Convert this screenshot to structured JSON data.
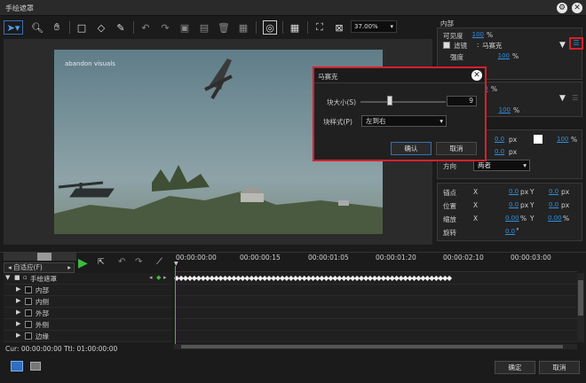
{
  "window": {
    "title": "手绘遮罩"
  },
  "toolbar": {
    "zoom": "37.00%"
  },
  "preview": {
    "watermark": "abandon visuals"
  },
  "props": {
    "section_inside": "内部",
    "visibility_label": "可见度",
    "visibility_value": "100",
    "pct": "%",
    "filter_label": "滤镜",
    "filter_value": "马赛克",
    "strength_label": "强度",
    "strength_value": "100",
    "pct2": "%",
    "visibility2_value": "0",
    "strength2_value": "100",
    "px1": "0.0",
    "px_unit": "px",
    "color_pct": "100",
    "px2": "0.0",
    "direction_label": "方向",
    "direction_value": "两者",
    "anchor_label": "锚点",
    "position_label": "位置",
    "scale_label": "缩放",
    "rotate_label": "旋转",
    "x": "X",
    "y": "Y",
    "anchor_x": "0.0",
    "anchor_y": "0.0",
    "pos_x": "0.0",
    "pos_y": "0.0",
    "scale_x": "0.00",
    "scale_y": "0.00",
    "rot": "0.0",
    "deg": "°"
  },
  "dialog": {
    "title": "马赛克",
    "block_size_label": "块大小(S)",
    "block_size_value": "9",
    "block_style_label": "块样式(P)",
    "block_style_value": "左到右",
    "ok": "确认",
    "cancel": "取消"
  },
  "timeline": {
    "fit_label": "自适应(F)",
    "times": [
      "00:00:00:00",
      "00:00:00:15",
      "00:00:01:05",
      "00:00:01:20",
      "00:00:02:10",
      "00:00:03:00"
    ],
    "root_track": "手绘遮罩",
    "tracks": [
      "内部",
      "内侧",
      "外部",
      "外侧",
      "边缘"
    ],
    "cur": "Cur: 00:00:00:00",
    "ttl": "Ttl: 01:00:00:00"
  },
  "footer": {
    "ok": "确定",
    "cancel": "取消"
  },
  "colors": {
    "accent_blue": "#2f8fe0",
    "highlight_red": "#d71f2b",
    "play_green": "#3dbb3d"
  }
}
